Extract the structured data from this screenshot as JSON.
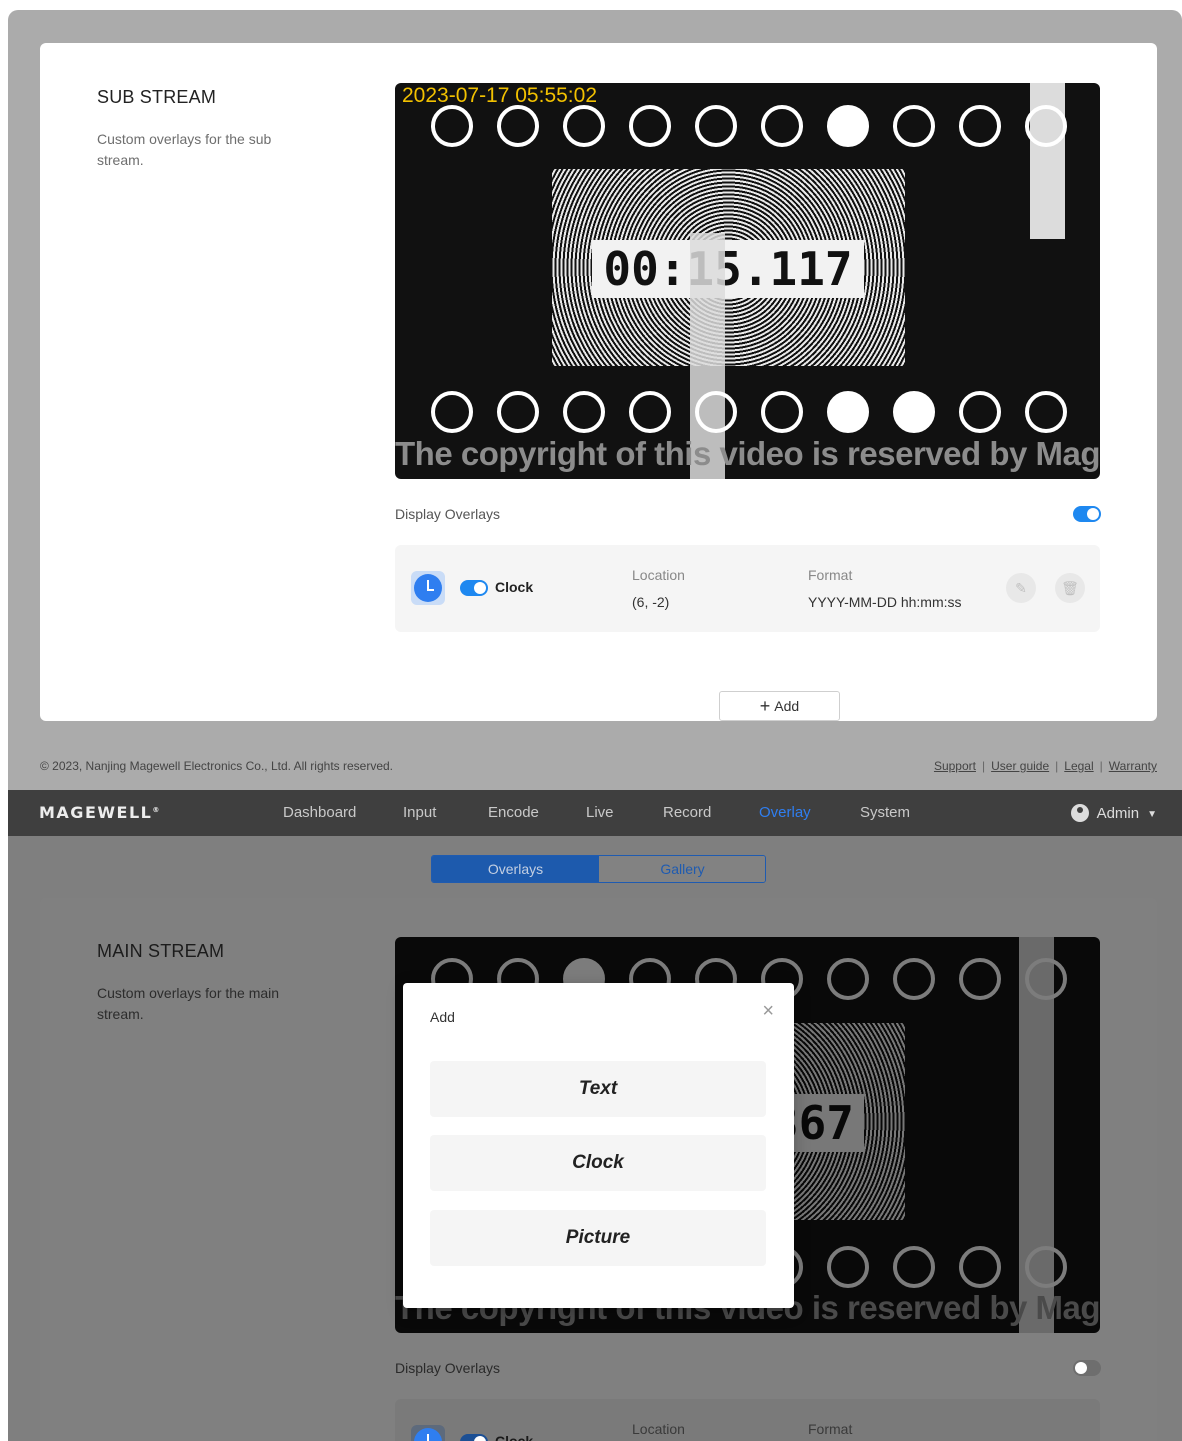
{
  "sub_stream": {
    "title": "SUB STREAM",
    "description": "Custom overlays for the sub stream.",
    "video": {
      "timestamp": "2023-07-17 05:55:02",
      "timer": "00:15.117",
      "copyright": "The copyright of this video is reserved by Magewell"
    },
    "display_overlays_label": "Display Overlays",
    "display_overlays_on": true,
    "overlay": {
      "enabled": true,
      "name": "Clock",
      "location_label": "Location",
      "location_value": "(6, -2)",
      "format_label": "Format",
      "format_value": "YYYY-MM-DD hh:mm:ss"
    },
    "add_label": "Add"
  },
  "footer": {
    "copyright": "© 2023, Nanjing Magewell Electronics Co., Ltd. All rights reserved.",
    "links": [
      "Support",
      "User guide",
      "Legal",
      "Warranty"
    ]
  },
  "nav": {
    "logo": "MAGEWELL",
    "items": [
      "Dashboard",
      "Input",
      "Encode",
      "Live",
      "Record",
      "Overlay",
      "System"
    ],
    "active": "Overlay",
    "user": "Admin"
  },
  "tabs": {
    "overlays": "Overlays",
    "gallery": "Gallery"
  },
  "main_stream": {
    "title": "MAIN STREAM",
    "description": "Custom overlays for the main stream.",
    "video": {
      "timer_partial": "367",
      "copyright": "The copyright of this video is reserved by Magewell"
    },
    "display_overlays_label": "Display Overlays",
    "display_overlays_on": false,
    "overlay": {
      "name": "Clock",
      "location_label": "Location",
      "format_label": "Format"
    }
  },
  "modal": {
    "title": "Add",
    "close": "×",
    "options": [
      "Text",
      "Clock",
      "Picture"
    ]
  },
  "colors": {
    "accent": "#2f7ef0",
    "nav_bg": "#3f3f3f",
    "timestamp": "#f2c100"
  }
}
